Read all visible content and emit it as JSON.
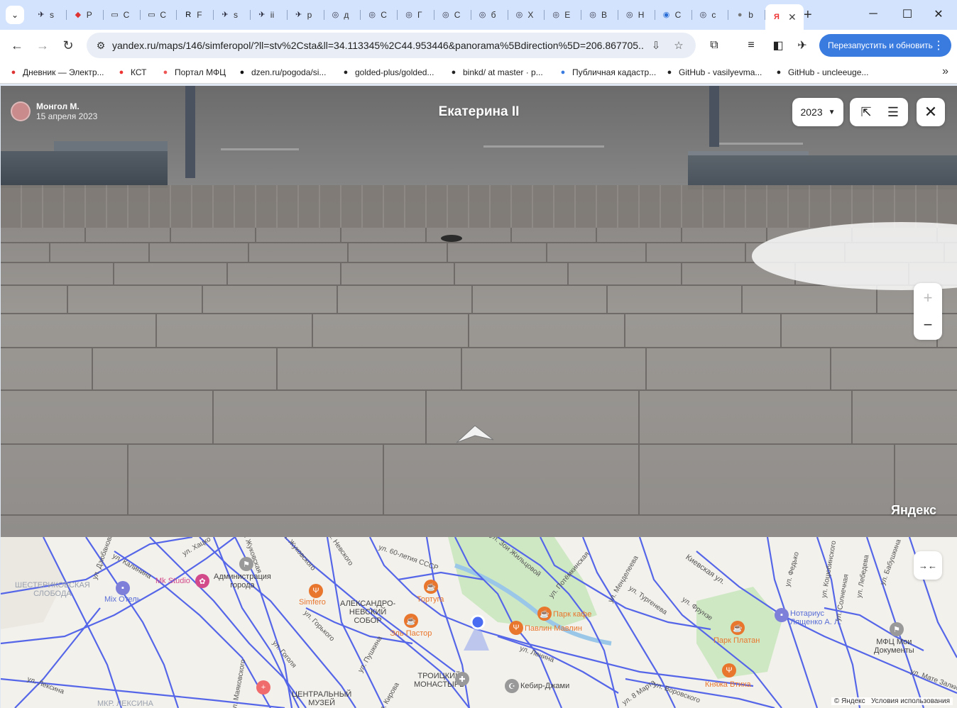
{
  "browser": {
    "tabs": [
      {
        "letter": "s",
        "icon": "bird-icon"
      },
      {
        "letter": "P",
        "icon": "kite-icon"
      },
      {
        "letter": "C",
        "icon": "monitor-icon"
      },
      {
        "letter": "C",
        "icon": "monitor-icon"
      },
      {
        "letter": "F",
        "icon": "r-icon"
      },
      {
        "letter": "s",
        "icon": "bird-icon"
      },
      {
        "letter": "ii",
        "icon": "bird-icon"
      },
      {
        "letter": "p",
        "icon": "bird-icon"
      },
      {
        "letter": "д",
        "icon": "ring-icon"
      },
      {
        "letter": "C",
        "icon": "ring-icon"
      },
      {
        "letter": "Г",
        "icon": "ring-icon"
      },
      {
        "letter": "C",
        "icon": "ring-icon"
      },
      {
        "letter": "б",
        "icon": "ring-icon"
      },
      {
        "letter": "X",
        "icon": "ring-icon"
      },
      {
        "letter": "E",
        "icon": "ring-icon"
      },
      {
        "letter": "B",
        "icon": "ring-icon"
      },
      {
        "letter": "H",
        "icon": "ring-icon"
      },
      {
        "letter": "C",
        "icon": "chrome-icon"
      },
      {
        "letter": "c",
        "icon": "ring-icon"
      },
      {
        "letter": "b",
        "icon": "globe-icon"
      }
    ],
    "active_tab": {
      "letter": "Я"
    },
    "url": "yandex.ru/maps/146/simferopol/?ll=stv%2Csta&ll=34.113345%2C44.953446&panorama%5Bdirection%5D=206.867705...",
    "relaunch_label": "Перезапустить и обновить",
    "bookmarks": [
      {
        "label": "Дневник — Электр...",
        "color": "#d33"
      },
      {
        "label": "КСТ",
        "color": "#e33"
      },
      {
        "label": "Портал МФЦ",
        "color": "#e55"
      },
      {
        "label": "dzen.ru/pogoda/si...",
        "color": "#111"
      },
      {
        "label": "golded-plus/golded...",
        "color": "#222"
      },
      {
        "label": "binkd/ at master · p...",
        "color": "#222"
      },
      {
        "label": "Публичная кадастр...",
        "color": "#3a7be0"
      },
      {
        "label": "GitHub - vasilyevma...",
        "color": "#222"
      },
      {
        "label": "GitHub - uncleeuge...",
        "color": "#222"
      }
    ]
  },
  "panorama": {
    "author_name": "Монгол М.",
    "author_date": "15 апреля 2023",
    "title": "Екатерина II",
    "year": "2023",
    "watermark": "Яндекс"
  },
  "minimap": {
    "districts": [
      {
        "text": "ШЕСТЕРИКОВСКАЯ\nСЛОБОДА"
      },
      {
        "text": "МКР. ЛЕКСИНА"
      }
    ],
    "places": [
      {
        "text": "Администрация\nгорода"
      },
      {
        "text": "АЛЕКСАНДРО-\nНЕВСКИЙ\nСОБОР"
      },
      {
        "text": "ТРОИЦКИЙ\nМОНАСТЫРЬ"
      },
      {
        "text": "ЦЕНТРАЛЬНЫЙ\nМУЗЕЙ"
      },
      {
        "text": "МФЦ Мои\nДокументы"
      }
    ],
    "poi": [
      {
        "text": "Mk Studio",
        "kind": "pink"
      },
      {
        "text": "Mix Отель",
        "kind": "blue"
      },
      {
        "text": "Simfero",
        "kind": "orange"
      },
      {
        "text": "Тортуга",
        "kind": "orange"
      },
      {
        "text": "Эль Пастор",
        "kind": "orange"
      },
      {
        "text": "Павлин Мавлин",
        "kind": "orange"
      },
      {
        "text": "Парк кафе",
        "kind": "orange"
      },
      {
        "text": "Кебир-Джами",
        "kind": "place"
      },
      {
        "text": "Парк Платан",
        "kind": "orange"
      },
      {
        "text": "Княжа Втиха",
        "kind": "orange"
      },
      {
        "text": "Нотариус\nЛященко А. Л.",
        "kind": "blue"
      }
    ],
    "streets": [
      "ул. Хацко",
      "ул. Калинина",
      "ул. Гоголя",
      "ул. Горького",
      "ул. Пушкина",
      "ул. Кирова",
      "ул. Ленина",
      "ул. Жуковского",
      "ул. Невского",
      "ул. 60-летия СССР",
      "ул. Зои Жильцовой",
      "ул. Потёмкинская",
      "ул. Менделеева",
      "ул. Тургенева",
      "Киевская ул.",
      "ул. Фрунзе",
      "ул. Федько",
      "ул. Коцюбинского",
      "ул. Лебедева",
      "ул. Бабушкина",
      "ул. Маяковского",
      "ул. Лексина",
      "ул. 8 Марта",
      "ул. Воровского",
      "ул. Солнечная",
      "ул. Мате Залки",
      "ул. Дзюбанова",
      "ул. Жуковская"
    ],
    "copyright": "© Яндекс",
    "terms": "Условия использования"
  }
}
